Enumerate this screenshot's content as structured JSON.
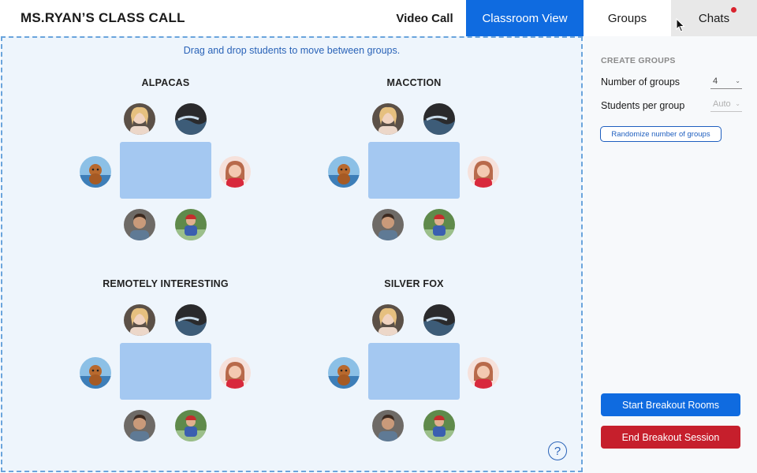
{
  "header": {
    "title": "MS.RYAN’S CLASS CALL",
    "tabs": [
      {
        "label": "Video Call",
        "active": false
      },
      {
        "label": "Classroom View",
        "active": true
      },
      {
        "label": "Groups",
        "active": false
      },
      {
        "label": "Chats",
        "active": false,
        "has_notification": true
      }
    ]
  },
  "classroom": {
    "hint": "Drag and drop students to move between groups.",
    "groups": [
      {
        "name": "ALPACAS"
      },
      {
        "name": "MACCTION"
      },
      {
        "name": "REMOTELY INTERESTING"
      },
      {
        "name": "SILVER FOX"
      }
    ],
    "help_label": "?"
  },
  "panel": {
    "heading": "CREATE GROUPS",
    "number_of_groups_label": "Number of groups",
    "number_of_groups_value": "4",
    "students_per_group_label": "Students per group",
    "students_per_group_value": "Auto",
    "randomize_label": "Randomize number of groups",
    "start_label": "Start Breakout Rooms",
    "end_label": "End Breakout Session"
  },
  "colors": {
    "accent_blue": "#0f6be0",
    "end_red": "#c61f2c",
    "table_blue": "#a4c8f1",
    "notification": "#d9232e"
  }
}
